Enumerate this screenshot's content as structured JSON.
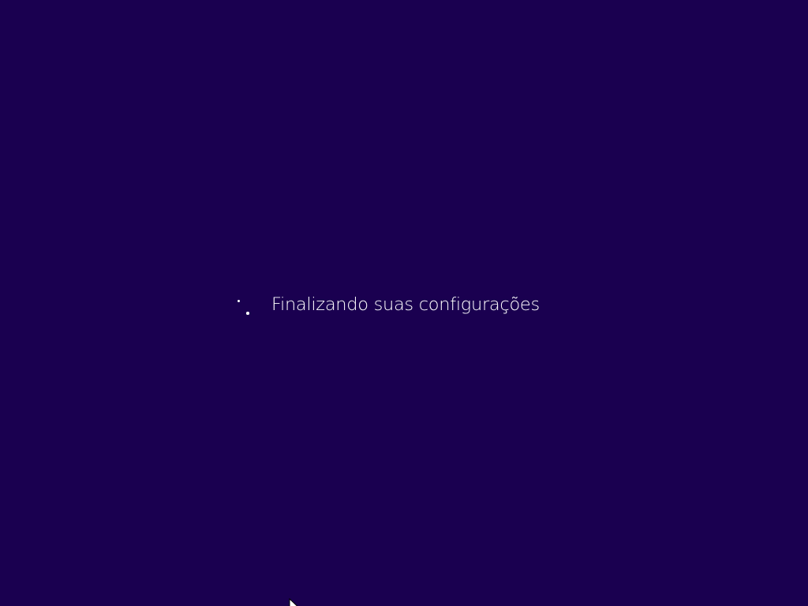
{
  "screen": {
    "background_color": "#1a0050",
    "status_text": "Finalizando suas configurações",
    "spinner_icon": "loading-dots-icon",
    "cursor_icon": "mouse-pointer-icon"
  }
}
